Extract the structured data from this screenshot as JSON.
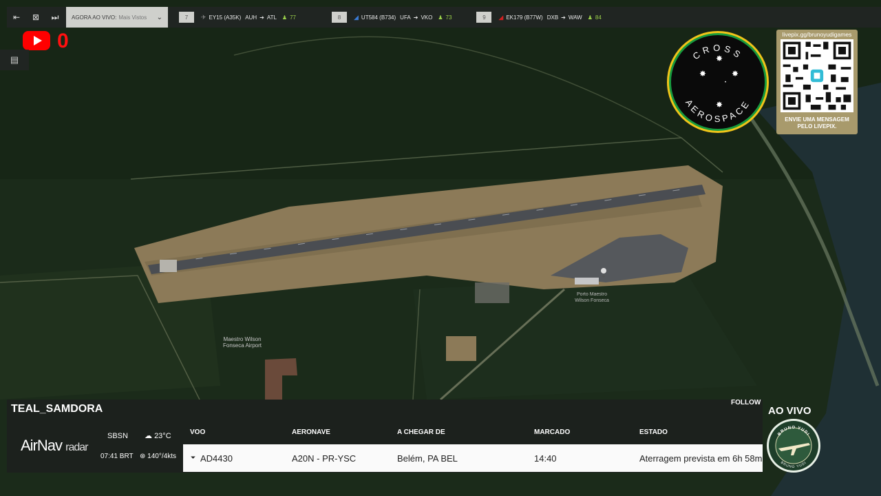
{
  "topbar": {
    "dropdown_live": "AGORA AO VIVO:",
    "dropdown_value": "Mais Vistos",
    "flights": [
      {
        "index": "7",
        "code": "EY15 (A35K)",
        "from": "AUH",
        "to": "ATL",
        "count": "77",
        "color": "#8a8a8a"
      },
      {
        "index": "8",
        "code": "UT584 (B734)",
        "from": "UFA",
        "to": "VKO",
        "count": "73",
        "color": "#3a7bd5"
      },
      {
        "index": "9",
        "code": "EK179 (B77W)",
        "from": "DXB",
        "to": "WAW",
        "count": "84",
        "color": "#d32020"
      }
    ]
  },
  "youtube": {
    "count": "0"
  },
  "overlay": {
    "logo_top": "CROSS",
    "logo_bottom": "AEROSPACE",
    "qr_url": "livepix.gg/brunoyudigames",
    "qr_message_1": "ENVIE UMA MENSAGEM",
    "qr_message_2": "PELO LIVEPIX.",
    "ao_vivo": "AO VIVO",
    "badge_top": "BRUNO YUDI",
    "badge_bottom": "BRUNO YUDI"
  },
  "map": {
    "airport_label_1": "Maestro Wilson",
    "airport_label_2": "Fonseca Airport",
    "poi_label_1": "Porto Maestro",
    "poi_label_2": "Wilson Fonseca"
  },
  "panel": {
    "callsign": "TEAL_SAMDORA",
    "follow": "FOLLOW",
    "brand": "AirNav",
    "brand_sub": "radar",
    "icao": "SBSN",
    "local_time": "07:41 BRT",
    "temperature": "23°C",
    "wind": "140°/4kts",
    "columns": [
      "VOO",
      "AERONAVE",
      "A CHEGAR DE",
      "MARCADO",
      "ESTADO"
    ],
    "row": {
      "flight": "AD4430",
      "aircraft": "A20N - PR-YSC",
      "origin": "Belém, PA BEL",
      "scheduled": "14:40",
      "status": "Aterragem prevista em 6h 58m"
    }
  }
}
